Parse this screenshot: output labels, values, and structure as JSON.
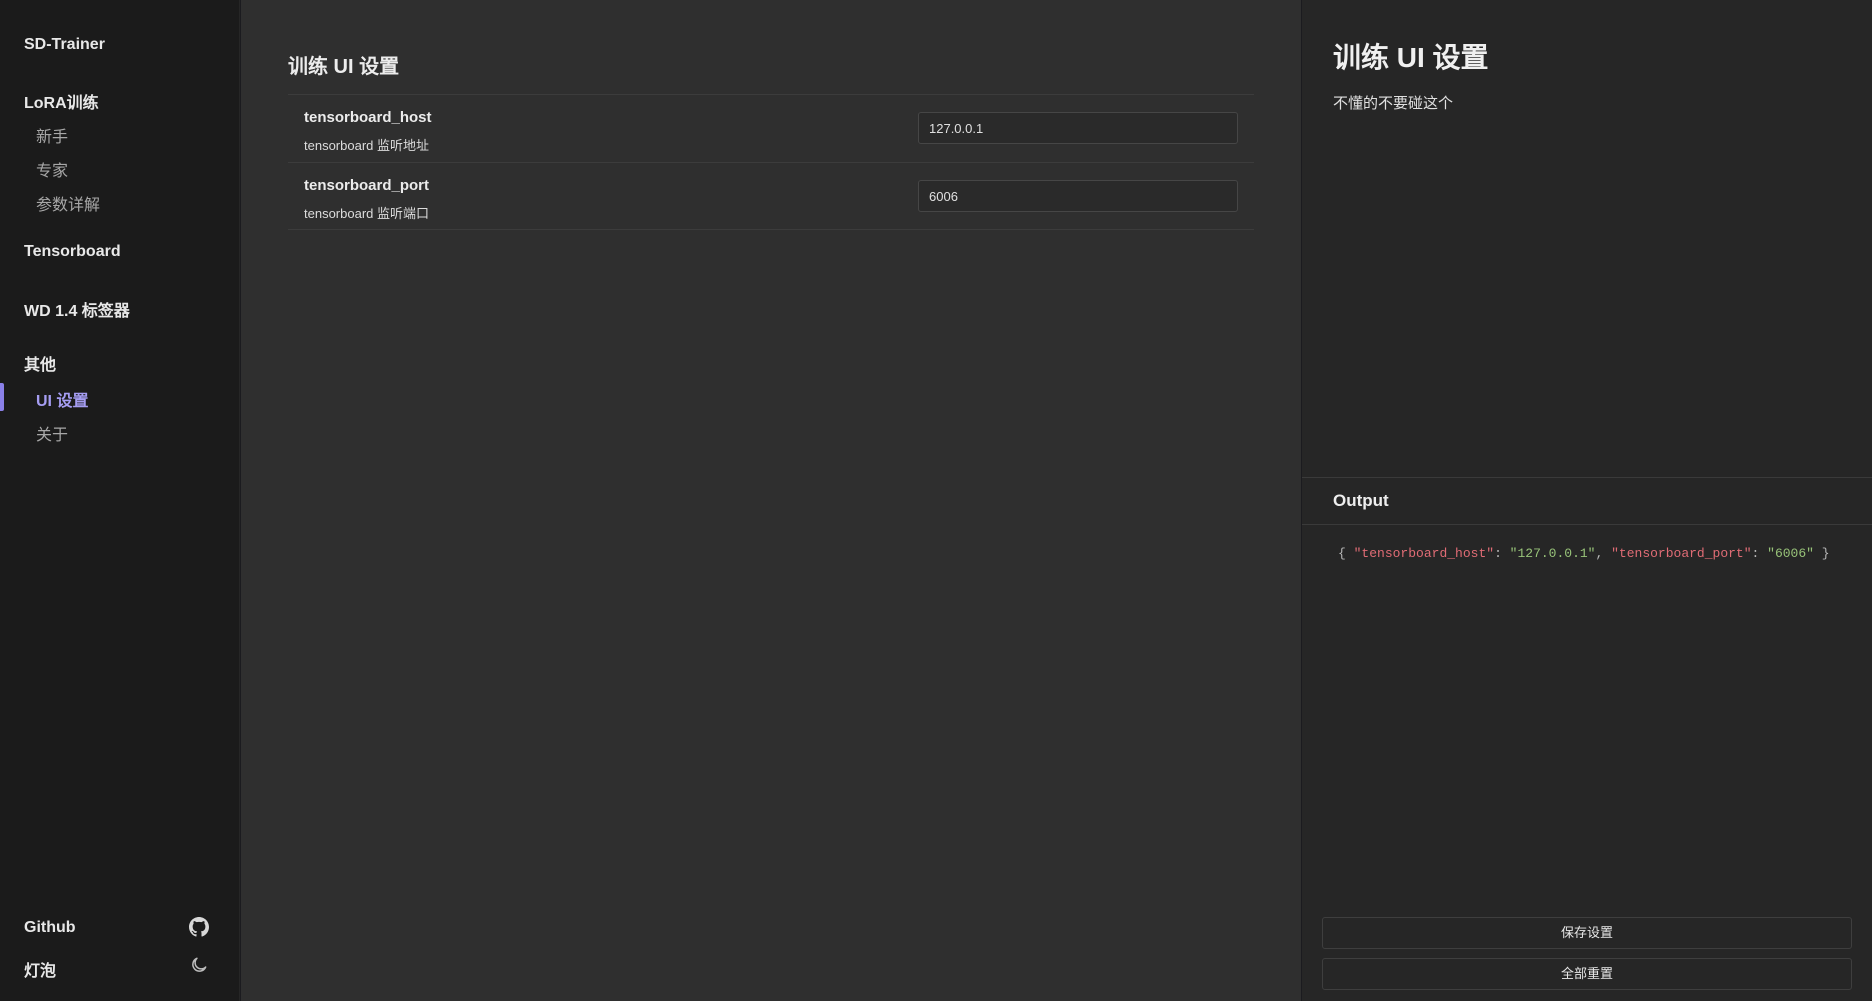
{
  "sidebar": {
    "brand": "SD-Trainer",
    "groups": [
      {
        "title": "LoRA训练",
        "items": [
          "新手",
          "专家",
          "参数详解"
        ]
      },
      {
        "title": "Tensorboard",
        "items": []
      },
      {
        "title": "WD 1.4 标签器",
        "items": []
      },
      {
        "title": "其他",
        "items": [
          "UI 设置",
          "关于"
        ]
      }
    ],
    "active_item": "UI 设置",
    "bottom": {
      "github_label": "Github",
      "github_icon": "github-icon",
      "theme_label": "灯泡",
      "theme_icon": "moon-icon"
    }
  },
  "main": {
    "title": "训练 UI 设置",
    "settings": [
      {
        "name": "tensorboard_host",
        "description": "tensorboard 监听地址",
        "value": "127.0.0.1"
      },
      {
        "name": "tensorboard_port",
        "description": "tensorboard 监听端口",
        "value": "6006"
      }
    ]
  },
  "right_panel": {
    "title": "训练 UI 设置",
    "description": "不懂的不要碰这个",
    "output_title": "Output",
    "output": {
      "open": "{",
      "k1": "\"tensorboard_host\"",
      "sep1": ": ",
      "v1": "\"127.0.0.1\"",
      "comma": ", ",
      "k2": "\"tensorboard_port\"",
      "sep2": ": ",
      "v2": "\"6006\"",
      "close": "}"
    },
    "save_button": "保存设置",
    "reset_button": "全部重置"
  },
  "colors": {
    "accent": "#8a80e8",
    "json_key": "#e06c75",
    "json_value": "#98c379"
  }
}
